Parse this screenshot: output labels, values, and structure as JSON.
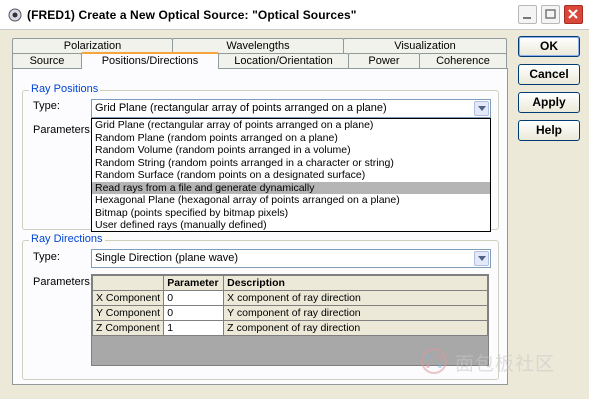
{
  "window": {
    "title": "(FRED1) Create a New Optical Source: \"Optical Sources\""
  },
  "tabs": {
    "row1": [
      "Polarization",
      "Wavelengths",
      "Visualization"
    ],
    "row2": [
      "Source",
      "Positions/Directions",
      "Location/Orientation",
      "Power",
      "Coherence"
    ],
    "active": "Positions/Directions"
  },
  "ray_positions": {
    "group_title": "Ray Positions",
    "type_label": "Type:",
    "parameters_label": "Parameters:",
    "type_value": "Grid Plane (rectangular array of points arranged on a plane)",
    "options": [
      "Grid Plane (rectangular array of points arranged on a plane)",
      "Random Plane (random points arranged on a plane)",
      "Random Volume (random points arranged in a volume)",
      "Random String (random points arranged in a character or string)",
      "Random Surface (random points on a designated surface)",
      "Read rays from a file and generate dynamically",
      "Hexagonal Plane (hexagonal array of points arranged on a plane)",
      "Bitmap (points specified by bitmap pixels)",
      "User defined rays (manually defined)"
    ],
    "highlighted_option": "Read rays from a file and generate dynamically"
  },
  "ray_directions": {
    "group_title": "Ray Directions",
    "type_label": "Type:",
    "type_value": "Single Direction (plane wave)",
    "parameters_label": "Parameters:",
    "table": {
      "headers": [
        "",
        "Parameter",
        "Description"
      ],
      "rows": [
        [
          "X Component",
          "0",
          "X component of ray direction"
        ],
        [
          "Y Component",
          "0",
          "Y component of ray direction"
        ],
        [
          "Z Component",
          "1",
          "Z component of ray direction"
        ]
      ]
    }
  },
  "buttons": {
    "ok": "OK",
    "cancel": "Cancel",
    "apply": "Apply",
    "help": "Help"
  },
  "watermark": {
    "text": "面包板社区"
  }
}
